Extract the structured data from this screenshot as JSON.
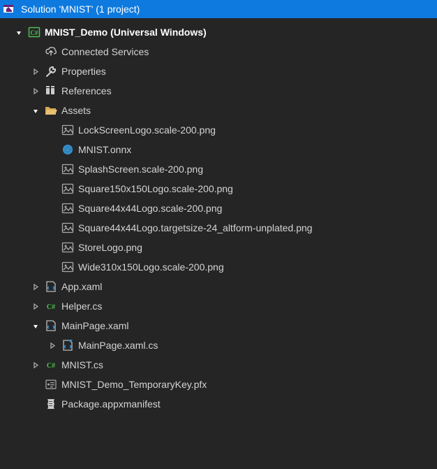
{
  "titlebar": {
    "text": "Solution 'MNIST' (1 project)"
  },
  "tree": {
    "project": "MNIST_Demo (Universal Windows)",
    "connected_services": "Connected Services",
    "properties": "Properties",
    "references": "References",
    "assets": {
      "label": "Assets",
      "items": [
        "LockScreenLogo.scale-200.png",
        "MNIST.onnx",
        "SplashScreen.scale-200.png",
        "Square150x150Logo.scale-200.png",
        "Square44x44Logo.scale-200.png",
        "Square44x44Logo.targetsize-24_altform-unplated.png",
        "StoreLogo.png",
        "Wide310x150Logo.scale-200.png"
      ]
    },
    "app_xaml": "App.xaml",
    "helper_cs": "Helper.cs",
    "mainpage": {
      "label": "MainPage.xaml",
      "child": "MainPage.xaml.cs"
    },
    "mnist_cs": "MNIST.cs",
    "pfx": "MNIST_Demo_TemporaryKey.pfx",
    "manifest": "Package.appxmanifest"
  }
}
